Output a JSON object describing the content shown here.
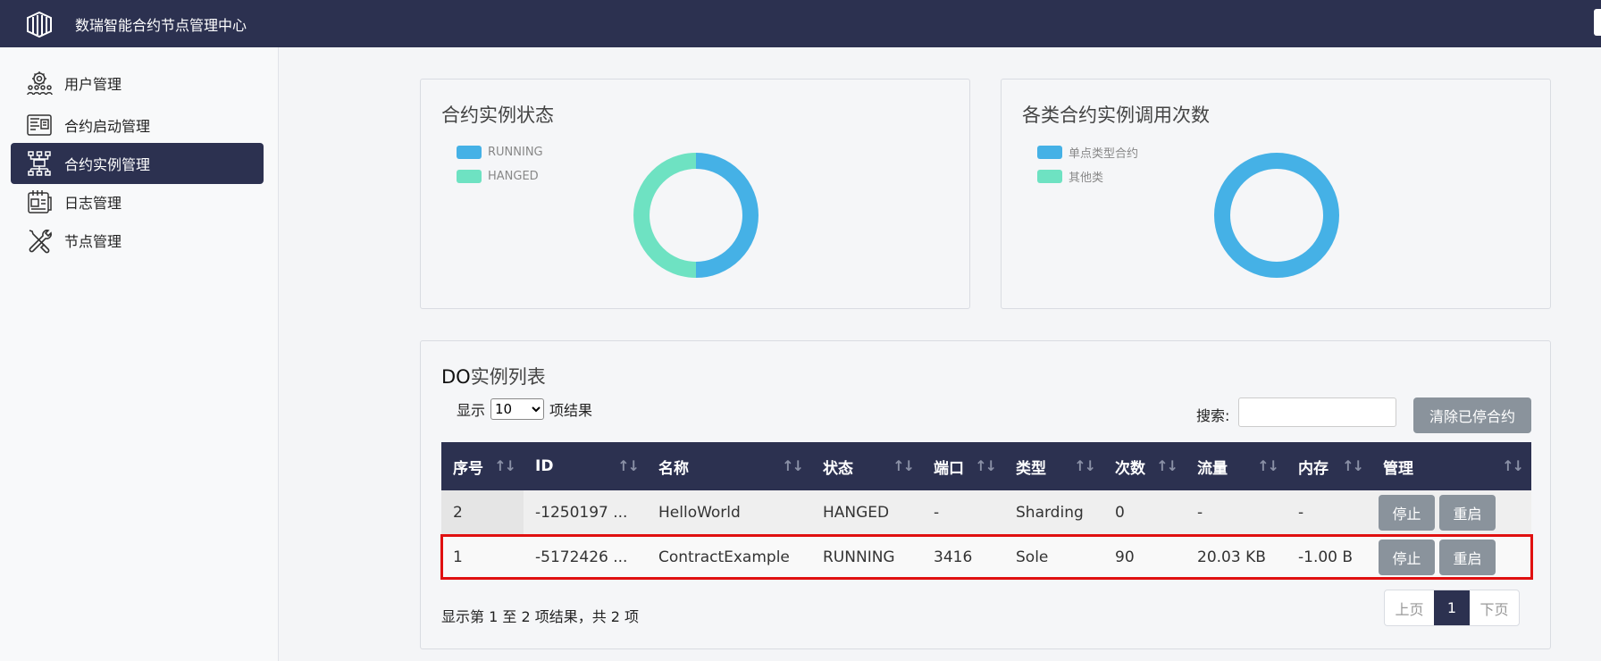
{
  "app": {
    "title": "数瑞智能合约节点管理中心"
  },
  "sidebar": {
    "items": [
      {
        "label": "用户管理",
        "icon": "users-gear-icon"
      },
      {
        "label": "合约启动管理",
        "icon": "contract-start-icon"
      },
      {
        "label": "合约实例管理",
        "icon": "network-nodes-icon",
        "active": true
      },
      {
        "label": "日志管理",
        "icon": "log-document-icon"
      },
      {
        "label": "节点管理",
        "icon": "wrench-screwdriver-icon"
      }
    ]
  },
  "status_panel": {
    "title": "合约实例状态",
    "legend": [
      "RUNNING",
      "HANGED"
    ]
  },
  "calls_panel": {
    "title": "各类合约实例调用次数",
    "legend": [
      "单点类型合约",
      "其他类"
    ]
  },
  "chart_data": [
    {
      "type": "pie",
      "title": "合约实例状态",
      "donut": true,
      "categories": [
        "RUNNING",
        "HANGED"
      ],
      "values": [
        1,
        1
      ],
      "colors": [
        "#45b1e6",
        "#6ee2c2"
      ]
    },
    {
      "type": "pie",
      "title": "各类合约实例调用次数",
      "donut": true,
      "categories": [
        "单点类型合约",
        "其他类"
      ],
      "values": [
        90,
        0
      ],
      "colors": [
        "#45b1e6",
        "#6ee2c2"
      ]
    }
  ],
  "list": {
    "title_prefix": "DO",
    "title_suffix": "实例列表",
    "length_prefix": "显示",
    "length_value": "10",
    "length_suffix": "项结果",
    "search_label": "搜索:",
    "search_value": "",
    "clear_button": "清除已停合约",
    "columns": [
      "序号",
      "ID",
      "名称",
      "状态",
      "端口",
      "类型",
      "次数",
      "流量",
      "内存",
      "管理"
    ],
    "rows": [
      {
        "seq": "2",
        "id": "-1250197 ...",
        "name": "HelloWorld",
        "status": "HANGED",
        "port": "-",
        "type": "Sharding",
        "count": "0",
        "traffic": "-",
        "memory": "-",
        "stop": "停止",
        "restart": "重启"
      },
      {
        "seq": "1",
        "id": "-5172426 ...",
        "name": "ContractExample",
        "status": "RUNNING",
        "port": "3416",
        "type": "Sole",
        "count": "90",
        "traffic": "20.03 KB",
        "memory": "-1.00 B",
        "stop": "停止",
        "restart": "重启"
      }
    ],
    "info": "显示第 1 至 2 项结果，共 2 项",
    "pager": {
      "prev": "上页",
      "current": "1",
      "next": "下页"
    }
  }
}
